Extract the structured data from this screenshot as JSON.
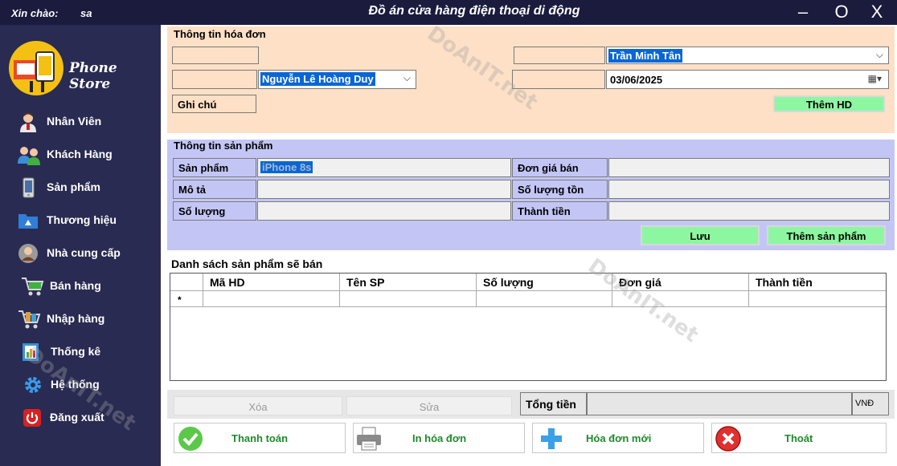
{
  "window": {
    "greeting": "Xin chào:",
    "user": "sa",
    "title": "Đồ án cửa hàng điện thoại di động",
    "minimize": "–",
    "maximize": "O",
    "close": "X"
  },
  "sidebar": {
    "logo_text": "Phone Store",
    "items": [
      {
        "label": "Nhân Viên",
        "icon": "staff-icon"
      },
      {
        "label": "Khách Hàng",
        "icon": "customers-icon"
      },
      {
        "label": "Sản phẩm",
        "icon": "phone-icon"
      },
      {
        "label": "Thương hiệu",
        "icon": "brand-icon"
      },
      {
        "label": "Nhà cung cấp",
        "icon": "supplier-icon"
      },
      {
        "label": "Bán hàng",
        "icon": "sale-cart-icon"
      },
      {
        "label": "Nhập hàng",
        "icon": "import-cart-icon"
      },
      {
        "label": "Thống kê",
        "icon": "statistics-icon"
      },
      {
        "label": "Hệ thống",
        "icon": "gear-icon"
      },
      {
        "label": "Đăng xuất",
        "icon": "power-icon"
      }
    ]
  },
  "invoice": {
    "title": "Thông tin hóa đơn",
    "customer": "Nguyễn Lê Hoàng Duy",
    "staff": "Trần Minh Tân",
    "date": "03/06/2025",
    "note_label": "Ghi chú",
    "add_invoice": "Thêm HD"
  },
  "product": {
    "title": "Thông tin sản phẩm",
    "product_label": "Sản phẩm",
    "product_value": "iPhone 8s",
    "desc_label": "Mô tả",
    "qty_label": "Số lượng",
    "price_label": "Đơn giá bán",
    "stock_label": "Số lượng tồn",
    "total_label": "Thành tiền",
    "save": "Lưu",
    "add_product": "Thêm sản phẩm"
  },
  "list": {
    "title": "Danh sách sản phẩm sẽ bán",
    "columns": [
      "Mã HD",
      "Tên SP",
      "Số lượng",
      "Đơn giá",
      "Thành tiền"
    ],
    "new_row_marker": "*"
  },
  "footer": {
    "delete": "Xóa",
    "edit": "Sửa",
    "total_label": "Tổng tiền",
    "currency": "VNĐ",
    "pay": "Thanh toán",
    "print": "In hóa đơn",
    "new_invoice": "Hóa đơn mới",
    "exit": "Thoát"
  },
  "watermark": "DoAnIT.net",
  "colors": {
    "titlebar": "#1a1b3d",
    "sidebar": "#2a2b52",
    "invoice_bg": "#fde0c6",
    "product_bg": "#c3c6f5",
    "green_button": "#8cf7a0",
    "selection": "#0a66d6"
  }
}
